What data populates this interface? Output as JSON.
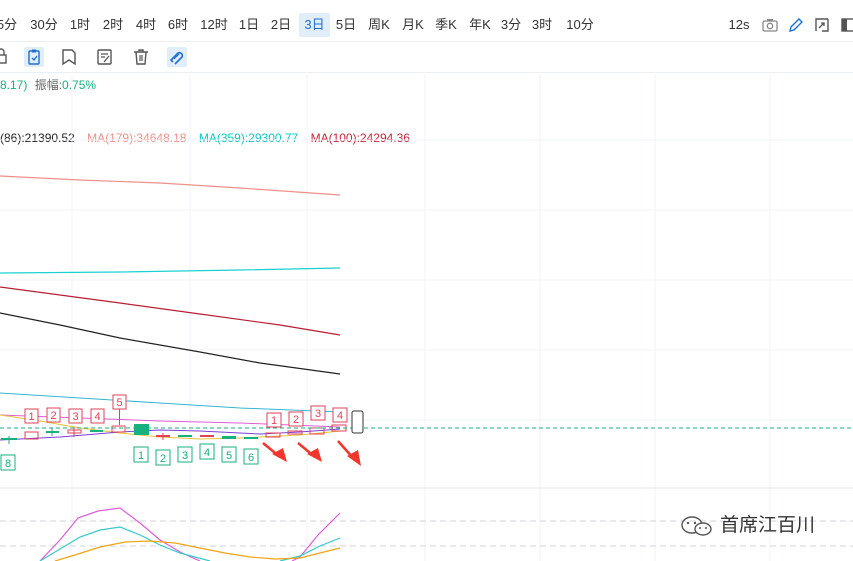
{
  "timeframes": [
    "5分",
    "30分",
    "1时",
    "2时",
    "4时",
    "6时",
    "12时",
    "1日",
    "2日",
    "3日",
    "5日",
    "周K",
    "月K",
    "季K",
    "年K",
    "3分",
    "3时",
    "10分"
  ],
  "active_timeframe": "3日",
  "refresh": "12s",
  "toolbar_icons": [
    "camera-icon",
    "pencil-icon",
    "expand-icon",
    "window-icon"
  ],
  "draw_icons": [
    "clipboard-icon",
    "bookmark-icon",
    "edit-note-icon",
    "trash-icon",
    "magnet-icon"
  ],
  "info": {
    "value": "8.17)",
    "amplitude_label": "振幅:",
    "amplitude_value": "0.75%"
  },
  "ma": [
    {
      "label": "(86):21390.52",
      "color": "#222222"
    },
    {
      "label": "MA(179):34648.18",
      "color": "#f0908a"
    },
    {
      "label": "MA(359):29300.77",
      "color": "#1ad1d1"
    },
    {
      "label": "MA(100):24294.36",
      "color": "#c0283a"
    }
  ],
  "top_markers": [
    "1",
    "2",
    "3",
    "4",
    "5"
  ],
  "green_markers": [
    "1",
    "2",
    "3",
    "4",
    "5",
    "6"
  ],
  "red_markers": [
    "1",
    "2",
    "3",
    "4"
  ],
  "left_green_marker": "8",
  "watermark": "首席江百川",
  "colors": {
    "up": "#e0425a",
    "down": "#17b07f",
    "active": "#1e6fd0"
  }
}
